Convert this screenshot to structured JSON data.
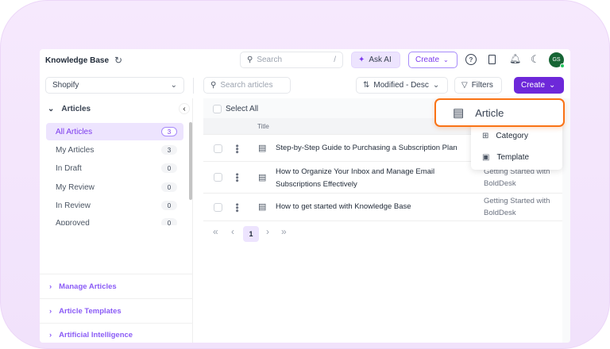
{
  "header": {
    "title": "Knowledge Base",
    "search_placeholder": "Search",
    "search_shortcut": "/",
    "ask_ai": "Ask AI",
    "create": "Create",
    "avatar": "GS"
  },
  "toolbar": {
    "brand_select": "Shopify",
    "search_articles_placeholder": "Search articles",
    "sort": "Modified - Desc",
    "filters": "Filters",
    "create": "Create"
  },
  "sidebar": {
    "section": "Articles",
    "items": [
      {
        "label": "All Articles",
        "count": "3"
      },
      {
        "label": "My Articles",
        "count": "3"
      },
      {
        "label": "In Draft",
        "count": "0"
      },
      {
        "label": "My Review",
        "count": "0"
      },
      {
        "label": "In Review",
        "count": "0"
      },
      {
        "label": "Approved",
        "count": "0"
      }
    ],
    "groups": [
      "Manage Articles",
      "Article Templates",
      "Artificial Intelligence"
    ]
  },
  "table": {
    "select_all": "Select All",
    "col_title": "Title",
    "rows": [
      {
        "title": "Step-by-Step Guide to Purchasing a Subscription Plan",
        "category": ""
      },
      {
        "title": "How to Organize Your Inbox and Manage Email Subscriptions Effectively",
        "category": "Getting Started with BoldDesk"
      },
      {
        "title": "How to get started with Knowledge Base",
        "category": "Getting Started with BoldDesk"
      }
    ]
  },
  "pagination": {
    "current": "1"
  },
  "create_menu": {
    "items": [
      "Article",
      "Category",
      "Template"
    ]
  },
  "colors": {
    "accent": "#6d28d9",
    "highlight": "#f97316",
    "selected_bg": "#ede4fe"
  }
}
